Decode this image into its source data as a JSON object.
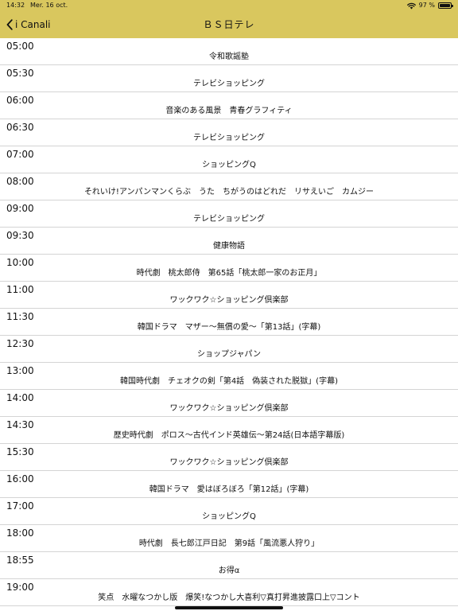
{
  "status_bar": {
    "time": "14:32",
    "date": "Mer. 16 oct.",
    "battery_text": "97 %",
    "battery_level": 0.97,
    "wifi_icon": "wifi-icon",
    "battery_icon": "battery-icon"
  },
  "nav": {
    "back_label": "i Canali",
    "back_icon": "chevron-left-icon",
    "title": "ＢＳ日テレ"
  },
  "colors": {
    "header_background": "#d9c75e",
    "row_separator": "#d4d4d4",
    "text": "#111111"
  },
  "schedule": [
    {
      "time": "05:00",
      "title": "令和歌謡塾"
    },
    {
      "time": "05:30",
      "title": "テレビショッピング"
    },
    {
      "time": "06:00",
      "title": "音楽のある風景　青春グラフィティ"
    },
    {
      "time": "06:30",
      "title": "テレビショッピング"
    },
    {
      "time": "07:00",
      "title": "ショッピングQ"
    },
    {
      "time": "08:00",
      "title": "それいけ!アンパンマンくらぶ　うた　ちがうのはどれだ　リサえいご　カムジー"
    },
    {
      "time": "09:00",
      "title": "テレビショッピング"
    },
    {
      "time": "09:30",
      "title": "健康物語"
    },
    {
      "time": "10:00",
      "title": "時代劇　桃太郎侍　第65話「桃太郎一家のお正月」"
    },
    {
      "time": "11:00",
      "title": "ワックワク☆ショッピング倶楽部"
    },
    {
      "time": "11:30",
      "title": "韓国ドラマ　マザー～無償の愛～「第13話」(字幕)"
    },
    {
      "time": "12:30",
      "title": "ショップジャパン"
    },
    {
      "time": "13:00",
      "title": "韓国時代劇　チェオクの剣「第4話　偽装された脱獄」(字幕)"
    },
    {
      "time": "14:00",
      "title": "ワックワク☆ショッピング倶楽部"
    },
    {
      "time": "14:30",
      "title": "歴史時代劇　ポロス～古代インド英雄伝～第24話(日本語字幕版)"
    },
    {
      "time": "15:30",
      "title": "ワックワク☆ショッピング倶楽部"
    },
    {
      "time": "16:00",
      "title": "韓国ドラマ　愛はぼろぼろ「第12話」(字幕)"
    },
    {
      "time": "17:00",
      "title": "ショッピングQ"
    },
    {
      "time": "18:00",
      "title": "時代劇　長七郎江戸日記　第9話「風流悪人狩り」"
    },
    {
      "time": "18:55",
      "title": "お得α"
    },
    {
      "time": "19:00",
      "title": "笑点　水曜なつかし版　爆笑!なつかし大喜利▽真打昇進披露口上▽コント"
    }
  ]
}
